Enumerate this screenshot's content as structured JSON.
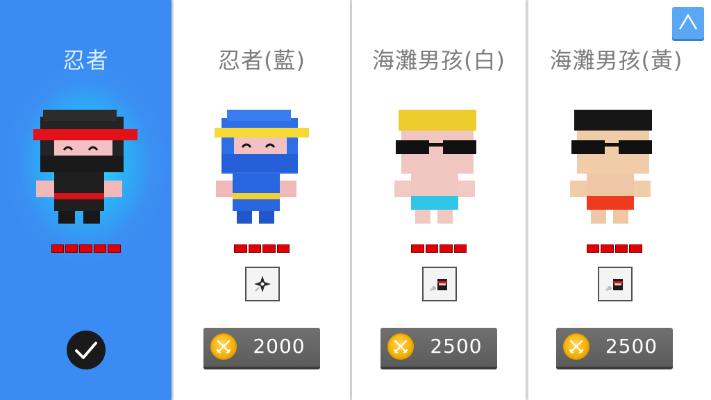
{
  "characters": [
    {
      "name": "忍者",
      "selected": true,
      "variant": "ninja-black",
      "power_segments": 5
    },
    {
      "name": "忍者(藍)",
      "selected": false,
      "variant": "ninja-blue",
      "power_segments": 4,
      "skill_icon": "shuriken-icon",
      "price": "2000"
    },
    {
      "name": "海灘男孩(白)",
      "selected": false,
      "variant": "beach-boy-white",
      "power_segments": 4,
      "skill_icon": "ninja-dash-icon",
      "price": "2500"
    },
    {
      "name": "海灘男孩(黃)",
      "selected": false,
      "variant": "beach-boy-yellow",
      "power_segments": 4,
      "skill_icon": "ninja-dash-icon",
      "price": "2500"
    }
  ],
  "selected_icon": "checkmark-icon",
  "currency_icon": "coin-icon",
  "scroll_button_icon": "chevron-up-icon",
  "colors": {
    "selected_panel": "#3a8cf2",
    "selected_glow": "#37e3ff",
    "power_bar": "#e20000",
    "price_button": "#666666",
    "coin": "#f5b200"
  }
}
